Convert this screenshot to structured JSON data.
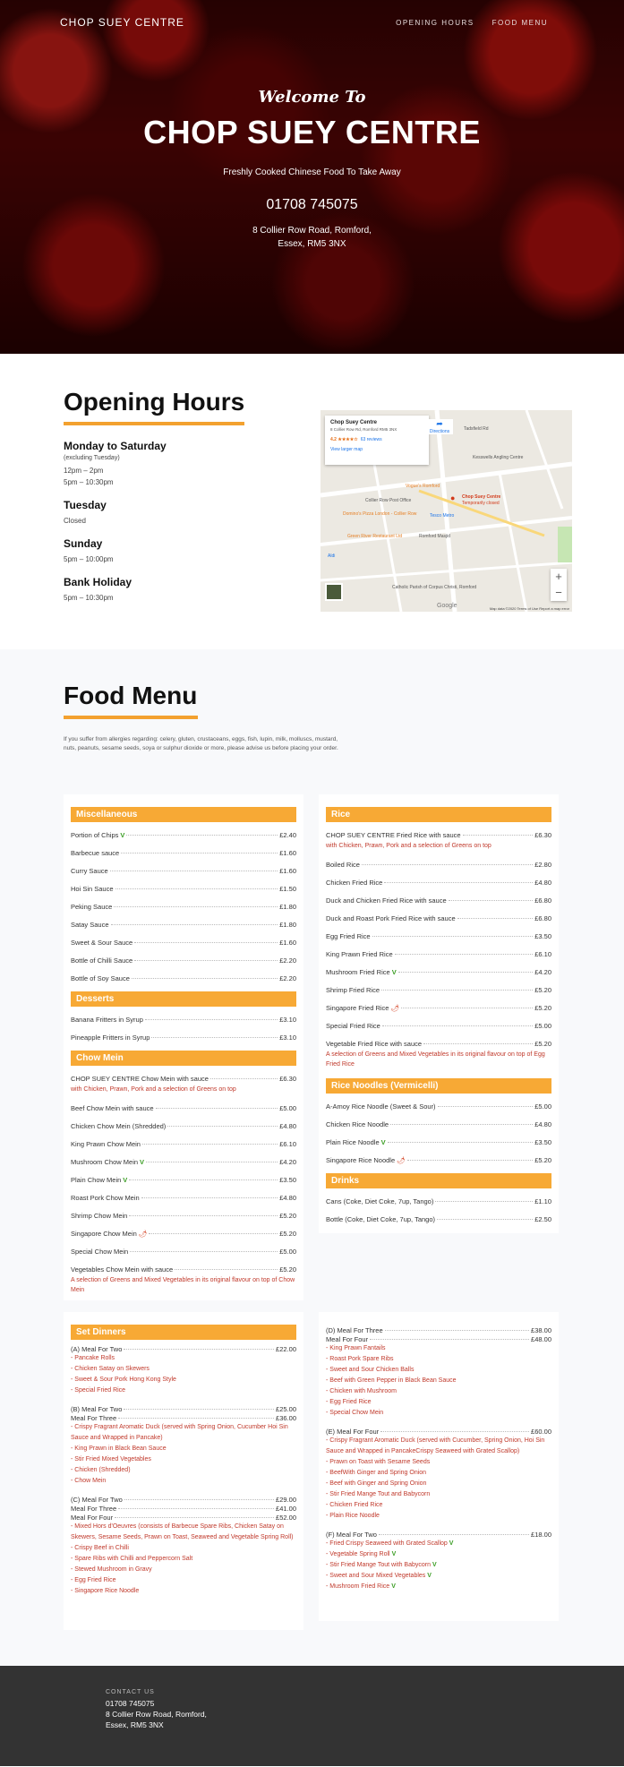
{
  "site": {
    "brand": "CHOP SUEY CENTRE",
    "nav": [
      "OPENING HOURS",
      "FOOD MENU"
    ]
  },
  "hero": {
    "welcome": "Welcome To",
    "title": "CHOP SUEY CENTRE",
    "tagline": "Freshly Cooked Chinese Food To Take Away",
    "phone": "01708 745075",
    "address_line1": "8 Collier Row Road, Romford,",
    "address_line2": "Essex, RM5 3NX"
  },
  "hours": {
    "title": "Opening Hours",
    "days": [
      {
        "day": "Monday to Saturday",
        "note": "(excluding Tuesday)",
        "times": [
          "12pm – 2pm",
          "5pm – 10:30pm"
        ]
      },
      {
        "day": "Tuesday",
        "times": [
          "Closed"
        ]
      },
      {
        "day": "Sunday",
        "times": [
          "5pm – 10:00pm"
        ]
      },
      {
        "day": "Bank Holiday",
        "times": [
          "5pm – 10:30pm"
        ]
      }
    ]
  },
  "map": {
    "place_name": "Chop Suey Centre",
    "place_address": "8 Collier Row Rd, Romford RM5 3NX",
    "rating": "4.2 ★★★★☆",
    "reviews": "63 reviews",
    "larger_map": "View larger map",
    "directions": "Directions",
    "marker_label": "Chop Suey Centre",
    "marker_status": "Temporarily closed",
    "labels": [
      "Vogue's Romford",
      "Collier Row Post Office",
      "Domino's Pizza London - Collier Row",
      "Tesco Metro",
      "Green River Restaurant Ltd",
      "Romford Masjid",
      "Aldi",
      "Catholic Parish of Corpus Christi, Romford",
      "Kesswells Angling Centre",
      "Tadsfield Rd"
    ],
    "zoom_in": "+",
    "zoom_out": "−",
    "google": "Google",
    "footer": "Map data ©2020   Terms of Use   Report a map error"
  },
  "menu": {
    "title": "Food Menu",
    "allergy": "If you suffer from allergies regarding: celery, gluten, crustaceans, eggs, fish, lupin, milk, molluscs, mustard, nuts, peanuts, sesame seeds, soya or sulphur dioxide or more, please advise us before placing your order.",
    "miscellaneous": {
      "title": "Miscellaneous",
      "items": [
        {
          "name": "Portion of Chips",
          "veg": true,
          "price": "£2.40"
        },
        {
          "name": "Barbecue sauce",
          "price": "£1.60"
        },
        {
          "name": "Curry Sauce",
          "price": "£1.60"
        },
        {
          "name": "Hoi Sin Sauce",
          "price": "£1.50"
        },
        {
          "name": "Peking Sauce",
          "price": "£1.80"
        },
        {
          "name": "Satay Sauce",
          "price": "£1.80"
        },
        {
          "name": "Sweet & Sour Sauce",
          "price": "£1.60"
        },
        {
          "name": "Bottle of Chilli Sauce",
          "price": "£2.20"
        },
        {
          "name": "Bottle of Soy Sauce",
          "price": "£2.20"
        }
      ]
    },
    "desserts": {
      "title": "Desserts",
      "items": [
        {
          "name": "Banana Fritters in Syrup",
          "price": "£3.10"
        },
        {
          "name": "Pineapple Fritters in Syrup",
          "price": "£3.10"
        }
      ]
    },
    "chow_mein": {
      "title": "Chow Mein",
      "first": {
        "name": "CHOP SUEY CENTRE Chow Mein with sauce",
        "price": "£6.30",
        "desc": "with Chicken, Prawn, Pork and a selection of Greens on top"
      },
      "items": [
        {
          "name": "Beef Chow Mein with sauce",
          "price": "£5.00"
        },
        {
          "name": "Chicken Chow Mein (Shredded)",
          "price": "£4.80"
        },
        {
          "name": "King Prawn Chow Mein",
          "price": "£6.10"
        },
        {
          "name": "Mushroom Chow Mein",
          "veg": true,
          "price": "£4.20"
        },
        {
          "name": "Plain Chow Mein",
          "veg": true,
          "price": "£3.50"
        },
        {
          "name": "Roast Pork Chow Mein",
          "price": "£4.80"
        },
        {
          "name": "Shrimp Chow Mein",
          "price": "£5.20"
        },
        {
          "name": "Singapore Chow Mein",
          "chili": true,
          "price": "£5.20"
        },
        {
          "name": "Special Chow Mein",
          "price": "£5.00"
        }
      ],
      "last": {
        "name": "Vegetables Chow Mein",
        "suffix": "with sauce",
        "price": "£5.20",
        "desc": "A selection of Greens and Mixed Vegetables in its original flavour on top of Chow Mein"
      }
    },
    "rice": {
      "title": "Rice",
      "first": {
        "name": "CHOP SUEY CENTRE Fried Rice with sauce",
        "price": "£6.30",
        "desc": "with Chicken, Prawn, Pork and a selection of Greens on top"
      },
      "items": [
        {
          "name": "Boiled Rice",
          "price": "£2.80"
        },
        {
          "name": "Chicken Fried Rice",
          "price": "£4.80"
        },
        {
          "name": "Duck and Chicken Fried Rice with sauce",
          "price": "£6.80"
        },
        {
          "name": "Duck and Roast Pork Fried Rice with sauce",
          "price": "£6.80"
        },
        {
          "name": "Egg Fried Rice",
          "price": "£3.50"
        },
        {
          "name": "King Prawn Fried Rice",
          "price": "£6.10"
        },
        {
          "name": "Mushroom Fried Rice",
          "veg": true,
          "price": "£4.20"
        },
        {
          "name": "Shrimp Fried Rice",
          "price": "£5.20"
        },
        {
          "name": "Singapore Fried Rice",
          "chili": true,
          "price": "£5.20"
        },
        {
          "name": "Special Fried Rice",
          "price": "£5.00"
        }
      ],
      "last": {
        "name": "Vegetable Fried Rice",
        "suffix": "with sauce",
        "price": "£5.20",
        "desc": "A selection of Greens and Mixed Vegetables in its original flavour on top of Egg Fried Rice"
      }
    },
    "rice_noodles": {
      "title": "Rice Noodles (Vermicelli)",
      "items": [
        {
          "name": "A-Amoy Rice Noodle (Sweet & Sour)",
          "price": "£5.00"
        },
        {
          "name": "Chicken Rice Noodle",
          "price": "£4.80"
        },
        {
          "name": "Plain Rice Noodle",
          "veg": true,
          "price": "£3.50"
        },
        {
          "name": "Singapore Rice Noodle",
          "chili": true,
          "price": "£5.20"
        }
      ]
    },
    "drinks": {
      "title": "Drinks",
      "items": [
        {
          "name": "Cans (Coke, Diet Coke, 7up, Tango)",
          "price": "£1.10"
        },
        {
          "name": "Bottle (Coke, Diet Coke, 7up, Tango)",
          "price": "£2.50"
        }
      ]
    },
    "set_dinners": {
      "title": "Set Dinners",
      "a": {
        "lines": [
          {
            "name": "(A) Meal For Two",
            "price": "£22.00"
          }
        ],
        "items": [
          "- Pancake Rolls",
          "- Chicken Satay on Skewers",
          "- Sweet & Sour Pork Hong Kong Style",
          "- Special Fried Rice"
        ]
      },
      "b": {
        "lines": [
          {
            "name": "(B) Meal For Two",
            "price": "£25.00"
          },
          {
            "name": "Meal For Three",
            "price": "£36.00"
          }
        ],
        "items": [
          "- Crispy Fragrant Aromatic Duck (served with Spring Onion, Cucumber Hoi Sin Sauce and Wrapped in Pancake)",
          "- King Prawn in Black Bean Sauce",
          "- Stir Fried Mixed Vegetables",
          "- Chicken (Shredded)",
          "- Chow Mein"
        ]
      },
      "c": {
        "lines": [
          {
            "name": "(C) Meal For Two",
            "price": "£29.00"
          },
          {
            "name": "Meal For Three",
            "price": "£41.00"
          },
          {
            "name": "Meal For Four",
            "price": "£52.00"
          }
        ],
        "items": [
          "- Mixed Hors d'Oeuvres (consists of Barbecue Spare Ribs, Chicken Satay on Skewers, Sesame Seeds, Prawn on Toast, Seaweed and Vegetable Spring Roll)",
          "- Crispy Beef in Chilli",
          "- Spare Ribs with Chilli and Peppercorn Salt",
          "- Stewed Mushroom in Gravy",
          "- Egg Fried Rice",
          "- Singapore Rice Noodle"
        ]
      },
      "d": {
        "lines": [
          {
            "name": "(D) Meal For Three",
            "price": "£38.00"
          },
          {
            "name": "Meal For Four",
            "price": "£48.00"
          }
        ],
        "items": [
          "- King Prawn Fantails",
          "- Roast Pork Spare Ribs",
          "- Sweet and Sour Chicken Balls",
          "- Beef with Green Pepper in Black Bean Sauce",
          "- Chicken with Mushroom",
          "- Egg Fried Rice",
          "- Special Chow Mein"
        ]
      },
      "e": {
        "lines": [
          {
            "name": "(E) Meal For Four",
            "price": "£60.00"
          }
        ],
        "items": [
          "- Crispy Fragrant Aromatic Duck (served with Cucumber, Spring Onion, Hoi Sin Sauce and Wrapped in PancakeCrispy Seaweed with Grated Scallop)",
          "- Prawn on Toast with Sesame Seeds",
          "- BeefWith Ginger and Spring Onion",
          "- Beef with Ginger and Spring Onion",
          "- Stir Fried Mange Tout and Babycorn",
          "- Chicken Fried Rice",
          "- Plain Rice Noodle"
        ]
      },
      "f": {
        "lines": [
          {
            "name": "(F) Meal For Two",
            "price": "£18.00"
          }
        ],
        "items": [
          "- Fried Crispy Seaweed with Grated Scallop",
          "- Vegetable Spring Roll",
          "- Stir Fried Mange Tout with Babycorn",
          "- Sweet and Sour Mixed Vegetables",
          "- Mushroom Fried Rice"
        ],
        "veg_flags": [
          true,
          true,
          true,
          true,
          true
        ]
      }
    }
  },
  "footer": {
    "label": "CONTACT US",
    "phone": "01708 745075",
    "addr1": "8 Collier Row Road, Romford,",
    "addr2": "Essex, RM5 3NX"
  },
  "colors": {
    "accent": "#f7a935",
    "red_text": "#c0392b",
    "veg": "#3a9d23",
    "footer_bg": "#333333"
  }
}
